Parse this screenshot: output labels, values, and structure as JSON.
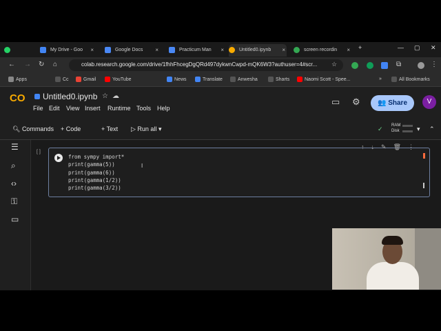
{
  "browser": {
    "tabs": [
      {
        "label": "My Drive - Goo",
        "color": "#4285f4"
      },
      {
        "label": "Google Docs",
        "color": "#4a88f5"
      },
      {
        "label": "Practicum Man",
        "color": "#4a88f5"
      },
      {
        "label": "Untitled0.ipynb",
        "color": "#f9ab00"
      },
      {
        "label": "screen recordin",
        "color": "#34a853"
      }
    ],
    "url": "colab.research.google.com/drive/1fhhFhcegDgQRd497dykwnCwpd-mQK6W3?authuser=4#scr...",
    "bookmarks": [
      {
        "label": "Apps",
        "color": "#888888"
      },
      {
        "label": "Cc",
        "color": "#555555"
      },
      {
        "label": "Gmail",
        "color": "#ea4335"
      },
      {
        "label": "YouTube",
        "color": "#ff0000"
      },
      {
        "label": "News",
        "color": "#4285f4"
      },
      {
        "label": "Translate",
        "color": "#4285f4"
      },
      {
        "label": "Anwesha",
        "color": "#555555"
      },
      {
        "label": "Sharts",
        "color": "#555555"
      },
      {
        "label": "Naomi Scott - Spee...",
        "color": "#ff0000"
      },
      {
        "label": "All Bookmarks",
        "color": "#555555"
      }
    ]
  },
  "colab": {
    "logo": "CO",
    "notebook_title": "Untitled0.ipynb",
    "menu": [
      "File",
      "Edit",
      "View",
      "Insert",
      "Runtime",
      "Tools",
      "Help"
    ],
    "share_label": "Share",
    "avatar_letter": "V",
    "toolbar": {
      "commands": "Commands",
      "code": "+ Code",
      "text": "+ Text",
      "run_all": "Run all",
      "ram": "RAM",
      "disk": "Disk"
    },
    "cell": {
      "bracket": "[ ]",
      "lines": [
        "from sympy import*",
        "print(gamma(5))",
        "print(gamma(6))",
        "print(gamma(1/2))",
        "print(gamma(3/2))"
      ]
    }
  }
}
